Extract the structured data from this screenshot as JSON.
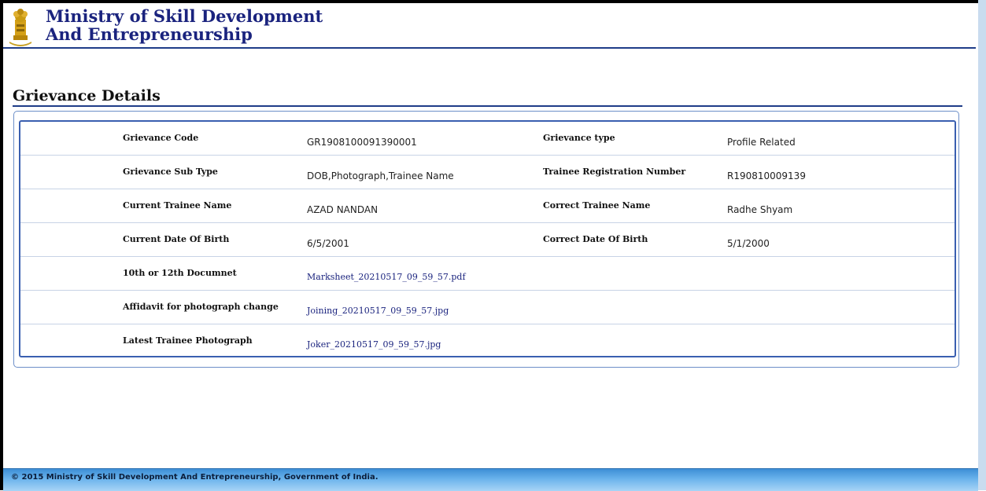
{
  "header": {
    "title_line1": "Ministry of Skill Development",
    "title_line2": "And Entrepreneurship"
  },
  "page": {
    "heading": "Grievance Details"
  },
  "details": {
    "grievance_code_label": "Grievance Code",
    "grievance_code_value": "GR1908100091390001",
    "grievance_type_label": "Grievance type",
    "grievance_type_value": "Profile Related",
    "grievance_sub_type_label": "Grievance Sub Type",
    "grievance_sub_type_value": "DOB,Photograph,Trainee Name",
    "trainee_reg_label": "Trainee Registration Number",
    "trainee_reg_value": "R190810009139",
    "current_name_label": "Current Trainee Name",
    "current_name_value": "AZAD NANDAN",
    "correct_name_label": "Correct Trainee Name",
    "correct_name_value": "Radhe Shyam",
    "current_dob_label": "Current Date Of Birth",
    "current_dob_value": "6/5/2001",
    "correct_dob_label": "Correct Date Of Birth",
    "correct_dob_value": "5/1/2000",
    "document_label": "10th or 12th Documnet",
    "document_link": "Marksheet_20210517_09_59_57.pdf",
    "affidavit_label": "Affidavit for photograph change",
    "affidavit_link": "Joining_20210517_09_59_57.jpg",
    "photo_label": "Latest Trainee Photograph",
    "photo_link": "Joker_20210517_09_59_57.jpg"
  },
  "footer": {
    "text": "© 2015 Ministry of Skill Development And Entrepreneurship, Government of India."
  },
  "colors": {
    "title_blue": "#1a237e",
    "border_blue": "#1f3c88",
    "footer_blue": "#3d8fd6"
  },
  "icons": {
    "emblem": "national-emblem-icon"
  }
}
